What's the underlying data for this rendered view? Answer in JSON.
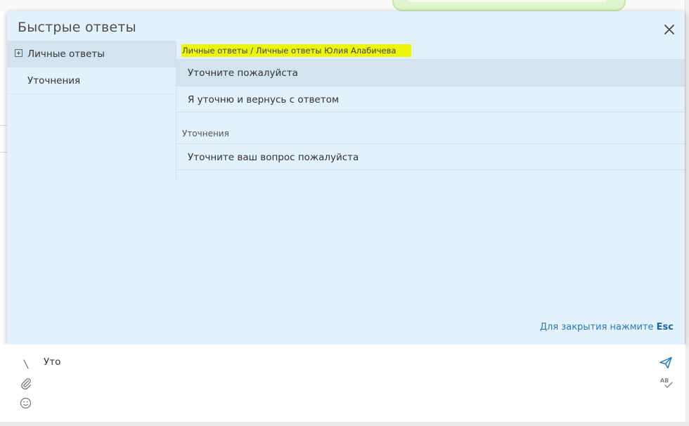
{
  "modal": {
    "title": "Быстрые ответы",
    "close_icon": "close-icon",
    "sidebar": {
      "items": [
        {
          "label": "Личные ответы",
          "icon": "expand-plus-icon",
          "active": true
        },
        {
          "label": "Уточнения",
          "active": false
        }
      ]
    },
    "content": {
      "breadcrumb": "Личные ответы / Личные ответы Юлия Алабичева",
      "groups": [
        {
          "label": "",
          "replies": [
            "Уточните пожалуйста",
            "Я уточню и вернусь с ответом"
          ]
        },
        {
          "label": "Уточнения",
          "replies": [
            "Уточните ваш вопрос пожалуйста"
          ]
        }
      ]
    },
    "esc_hint": {
      "text": "Для закрытия нажмите ",
      "key": "Esc"
    }
  },
  "composer": {
    "text": "Уто",
    "icons": [
      "slash-icon",
      "paperclip-icon",
      "emoji-icon",
      "send-icon",
      "spellcheck-icon"
    ]
  },
  "colors": {
    "modal_bg": "#e3f1fc",
    "selected_bg": "#d3e3ef",
    "highlight": "#ecf50a",
    "accent": "#2d7ab5"
  }
}
